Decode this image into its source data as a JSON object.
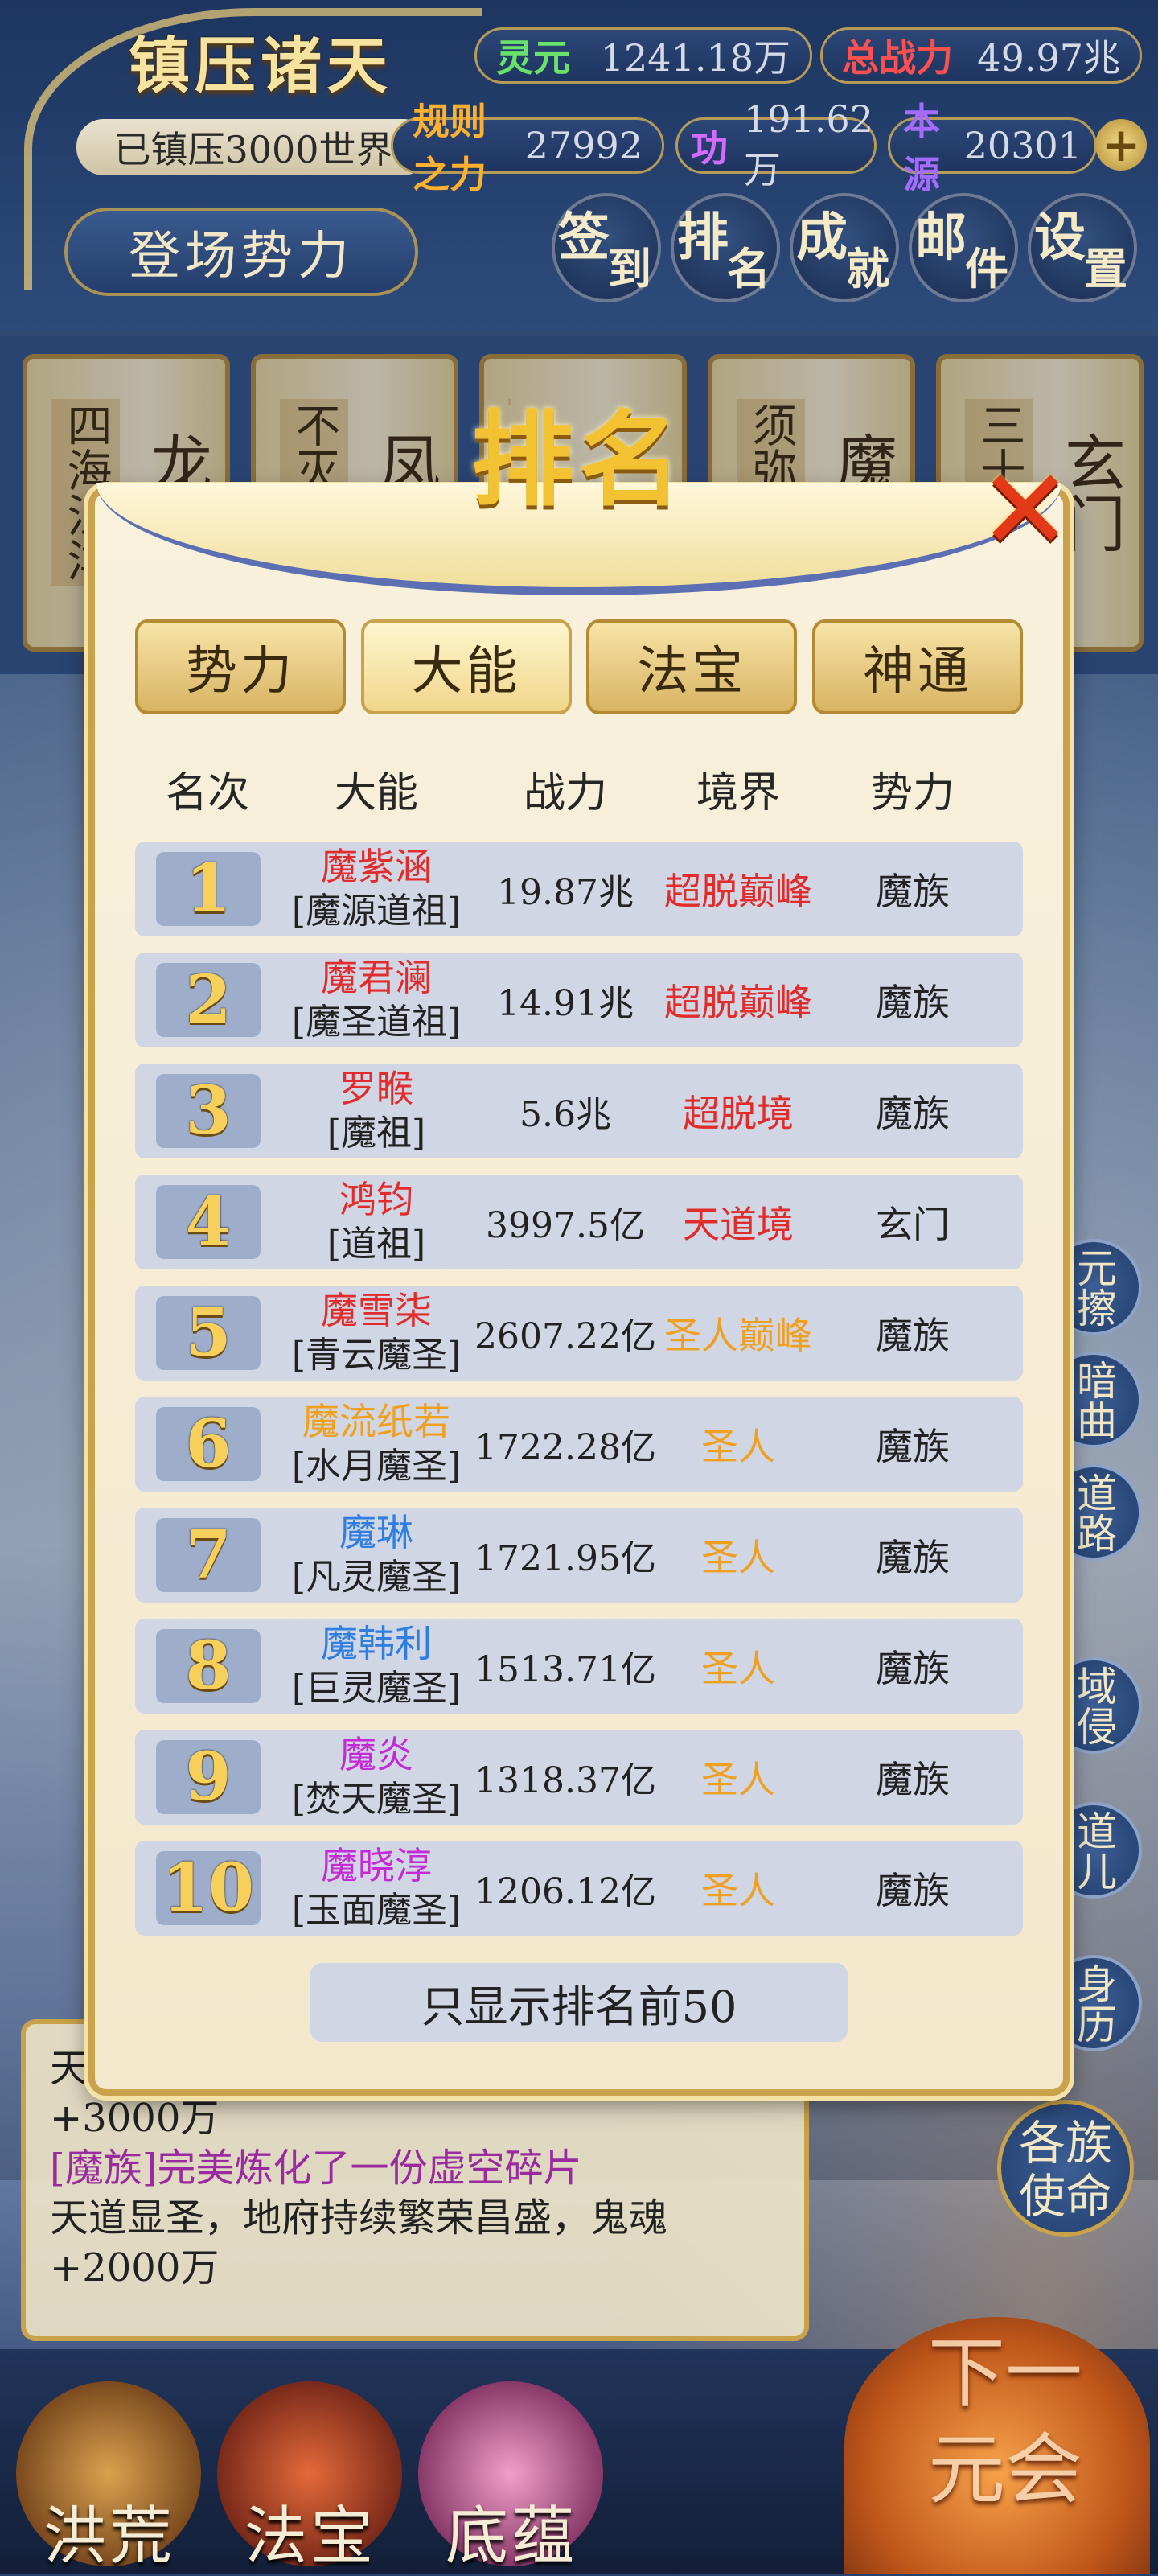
{
  "hud": {
    "world_title": "镇压诸天",
    "suppressed_text": "已镇压3000世界",
    "faction_button": "登场势力",
    "resources": [
      {
        "label": "灵元",
        "value": "1241.18万",
        "color": "#6ae26a"
      },
      {
        "label": "总战力",
        "value": "49.97兆",
        "color": "#ff5050"
      },
      {
        "label": "规则之力",
        "value": "27992",
        "color": "#ffb02e"
      },
      {
        "label": "功",
        "value": "191.62万",
        "color": "#d46bff"
      },
      {
        "label": "本源",
        "value": "20301",
        "color": "#a36bff"
      }
    ],
    "plus_symbol": "+",
    "nav": [
      {
        "c1": "签",
        "c2": "到"
      },
      {
        "c1": "排",
        "c2": "名"
      },
      {
        "c1": "成",
        "c2": "就"
      },
      {
        "c1": "邮",
        "c2": "件"
      },
      {
        "c1": "设",
        "c2": "置"
      }
    ]
  },
  "faction_cards": [
    {
      "v1": "四海汪洋",
      "v2": "龙"
    },
    {
      "v1": "不灭",
      "v2": "凤"
    },
    {
      "v1": "",
      "v2": ""
    },
    {
      "v1": "须弥",
      "v2": "魔"
    },
    {
      "v1": "三十",
      "v2": "玄门"
    }
  ],
  "modal": {
    "title": "排名",
    "close_symbol": "✕",
    "tabs": [
      "势力",
      "大能",
      "法宝",
      "神通"
    ],
    "active_tab_index": 1,
    "headers": {
      "rank": "名次",
      "name": "大能",
      "power": "战力",
      "realm": "境界",
      "faction": "势力"
    },
    "rows": [
      {
        "rank": "1",
        "name": "魔紫涵",
        "title": "[魔源道祖]",
        "power": "19.87兆",
        "realm": "超脱巅峰",
        "faction": "魔族",
        "name_color": "#e22b2b",
        "realm_color": "#e22b2b"
      },
      {
        "rank": "2",
        "name": "魔君澜",
        "title": "[魔圣道祖]",
        "power": "14.91兆",
        "realm": "超脱巅峰",
        "faction": "魔族",
        "name_color": "#e22b2b",
        "realm_color": "#e22b2b"
      },
      {
        "rank": "3",
        "name": "罗睺",
        "title": "[魔祖]",
        "power": "5.6兆",
        "realm": "超脱境",
        "faction": "魔族",
        "name_color": "#e22b2b",
        "realm_color": "#e22b2b"
      },
      {
        "rank": "4",
        "name": "鸿钧",
        "title": "[道祖]",
        "power": "3997.5亿",
        "realm": "天道境",
        "faction": "玄门",
        "name_color": "#e22b2b",
        "realm_color": "#e22b2b"
      },
      {
        "rank": "5",
        "name": "魔雪柒",
        "title": "[青云魔圣]",
        "power": "2607.22亿",
        "realm": "圣人巅峰",
        "faction": "魔族",
        "name_color": "#e22b2b",
        "realm_color": "#f0a020"
      },
      {
        "rank": "6",
        "name": "魔流纸若",
        "title": "[水月魔圣]",
        "power": "1722.28亿",
        "realm": "圣人",
        "faction": "魔族",
        "name_color": "#f0a020",
        "realm_color": "#f0a020"
      },
      {
        "rank": "7",
        "name": "魔琳",
        "title": "[凡灵魔圣]",
        "power": "1721.95亿",
        "realm": "圣人",
        "faction": "魔族",
        "name_color": "#2f7ee0",
        "realm_color": "#f0a020"
      },
      {
        "rank": "8",
        "name": "魔韩利",
        "title": "[巨灵魔圣]",
        "power": "1513.71亿",
        "realm": "圣人",
        "faction": "魔族",
        "name_color": "#2f7ee0",
        "realm_color": "#f0a020"
      },
      {
        "rank": "9",
        "name": "魔炎",
        "title": "[焚天魔圣]",
        "power": "1318.37亿",
        "realm": "圣人",
        "faction": "魔族",
        "name_color": "#c52ad6",
        "realm_color": "#f0a020"
      },
      {
        "rank": "10",
        "name": "魔晓淳",
        "title": "[玉面魔圣]",
        "power": "1206.12亿",
        "realm": "圣人",
        "faction": "魔族",
        "name_color": "#c52ad6",
        "realm_color": "#f0a020"
      }
    ],
    "footer_note": "只显示排名前50"
  },
  "log": {
    "line0": "天",
    "line1": "+3000万",
    "line2": "[魔族]完美炼化了一份虚空碎片",
    "line3": "天道显圣，地府持续繁荣昌盛，鬼魂",
    "line4": "+2000万"
  },
  "side_buttons": [
    "元擦",
    "暗曲",
    "道路",
    "域侵",
    "道儿",
    "身历"
  ],
  "side_big": "各族使命",
  "bottom_nav": [
    "洪荒",
    "法宝",
    "底蕴"
  ],
  "next_era": "下一元会"
}
